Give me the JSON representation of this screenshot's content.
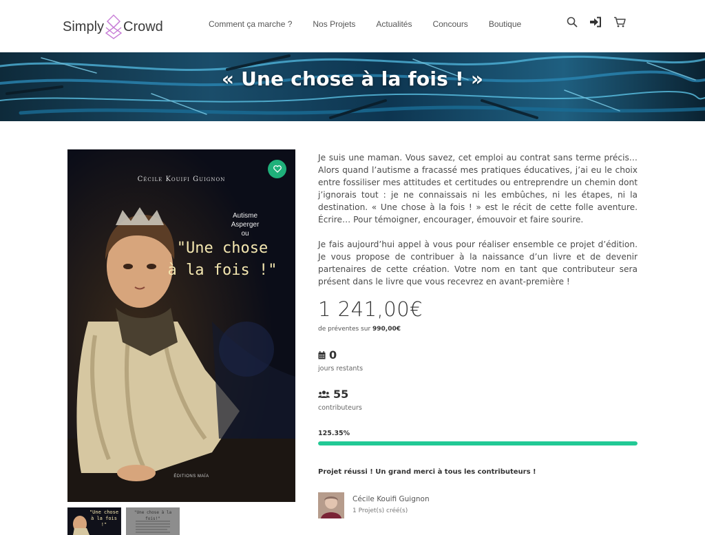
{
  "header": {
    "logo_left": "Simply",
    "logo_right": "Crowd",
    "nav": [
      "Comment ça marche ?",
      "Nos Projets",
      "Actualités",
      "Concours",
      "Boutique"
    ],
    "icons": [
      "search-icon",
      "sign-in-icon",
      "cart-icon"
    ]
  },
  "hero": {
    "title": "« Une chose à la fois ! »"
  },
  "cover": {
    "author": "Cécile Kouifi Guignon",
    "subtitle_lines": [
      "Autisme",
      "Asperger",
      "ou"
    ],
    "title_lines": [
      "\"Une chose",
      "à la fois !\""
    ],
    "publisher": "ÉDITIONS MAÏA"
  },
  "thumbs": {
    "t1_lines": [
      "\"Une chose",
      "à la fois !\""
    ],
    "t2_lines": [
      "\"Une chose à la fois!\""
    ]
  },
  "description": {
    "p1": "Je suis une maman. Vous savez, cet emploi au contrat sans terme précis… Alors quand l’autisme a fracassé mes pratiques éducatives, j’ai eu le choix entre fossiliser mes attitudes et certitudes ou entreprendre un chemin dont j’ignorais tout : je ne connaissais ni les embûches, ni les étapes, ni la destination. « Une chose à la fois ! » est le récit de cette folle aventure. Écrire… Pour témoigner, encourager, émouvoir et faire sourire.",
    "p2": "Je fais aujourd’hui appel à vous pour réaliser ensemble ce projet d’édition. Je vous propose de contribuer à la naissance d’un livre et de devenir partenaires de cette création. Votre nom en tant que contributeur sera présent dans le livre que vous recevrez en avant-première !"
  },
  "funding": {
    "amount": "1 241,00€",
    "sub_prefix": "de préventes sur",
    "goal": "990,00€",
    "days_value": "0",
    "days_label": "jours restants",
    "contributors_value": "55",
    "contributors_label": "contributeurs",
    "percent_text": "125.35%",
    "progress_fraction": 1.0,
    "success_message": "Projet réussi ! Un grand merci à tous les contributeurs !"
  },
  "creator": {
    "name": "Cécile Kouifi Guignon",
    "projects": "1 Projet(s) créé(s)"
  },
  "colors": {
    "accent": "#22c995",
    "favorite": "#1fb07a",
    "logo_mark": "#c77dd6"
  }
}
